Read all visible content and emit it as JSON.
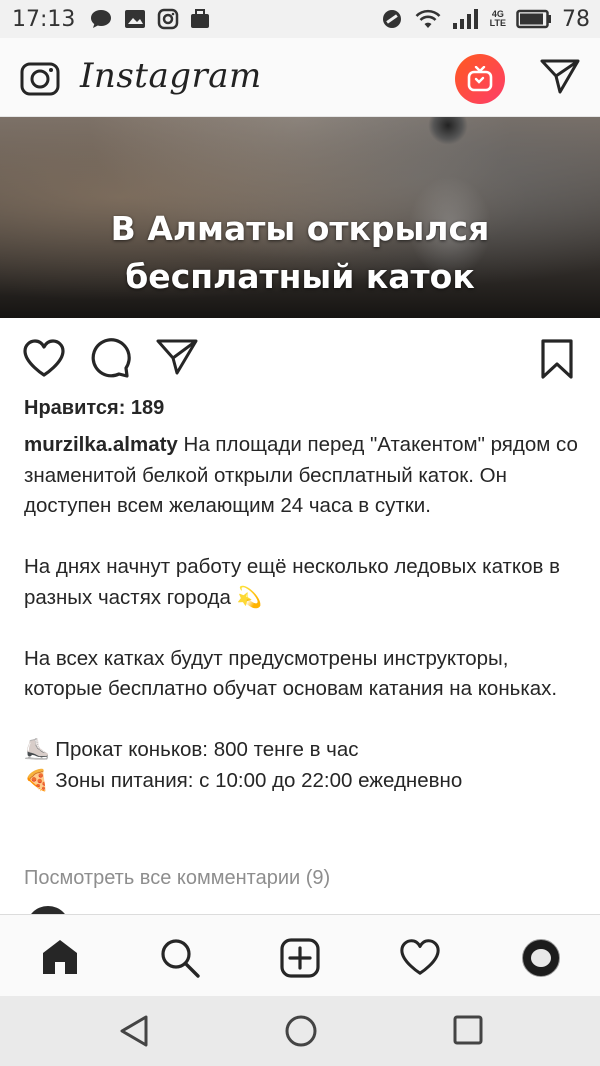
{
  "status_bar": {
    "time": "17:13",
    "battery": "78",
    "network": "4G",
    "lte": "LTE",
    "left_icons": [
      "chat-bubble-icon",
      "image-icon",
      "instagram-icon",
      "briefcase-icon"
    ],
    "right_icons": [
      "do-not-disturb-icon",
      "wifi-icon",
      "signal-icon",
      "battery-icon"
    ]
  },
  "app_bar": {
    "logo": "Instagram",
    "left_icon": "camera-icon",
    "right_icons": [
      "igtv-icon",
      "direct-message-icon"
    ],
    "igtv_color": "#fd4b45"
  },
  "post": {
    "image_headline_line1": "В Алматы открылся",
    "image_headline_line2": "бесплатный каток",
    "likes": "Нравится: 189",
    "username": "murzilka.almaty",
    "caption_first": " На площади перед \"Атакентом\" рядом со знаменитой белкой открыли бесплатный каток. Он доступен всем желающим 24 часа в сутки.",
    "caption_p2": "На днях начнут работу ещё несколько ледовых катков в разных частях города 💫",
    "caption_p3": "На всех катках будут предусмотрены инструкторы, которые бесплатно обучат основам катания на коньках.",
    "caption_line4": "⛸️ Прокат коньков: 800 тенге в час",
    "caption_line5": "🍕 Зоны питания: с 10:00 до 22:00 ежедневно",
    "view_comments": "Посмотреть все комментарии (9)"
  },
  "bottom_nav": [
    "home-icon",
    "search-icon",
    "add-post-icon",
    "activity-heart-icon",
    "profile-avatar"
  ],
  "system_nav": [
    "back-icon",
    "home-circle-icon",
    "recents-square-icon"
  ]
}
